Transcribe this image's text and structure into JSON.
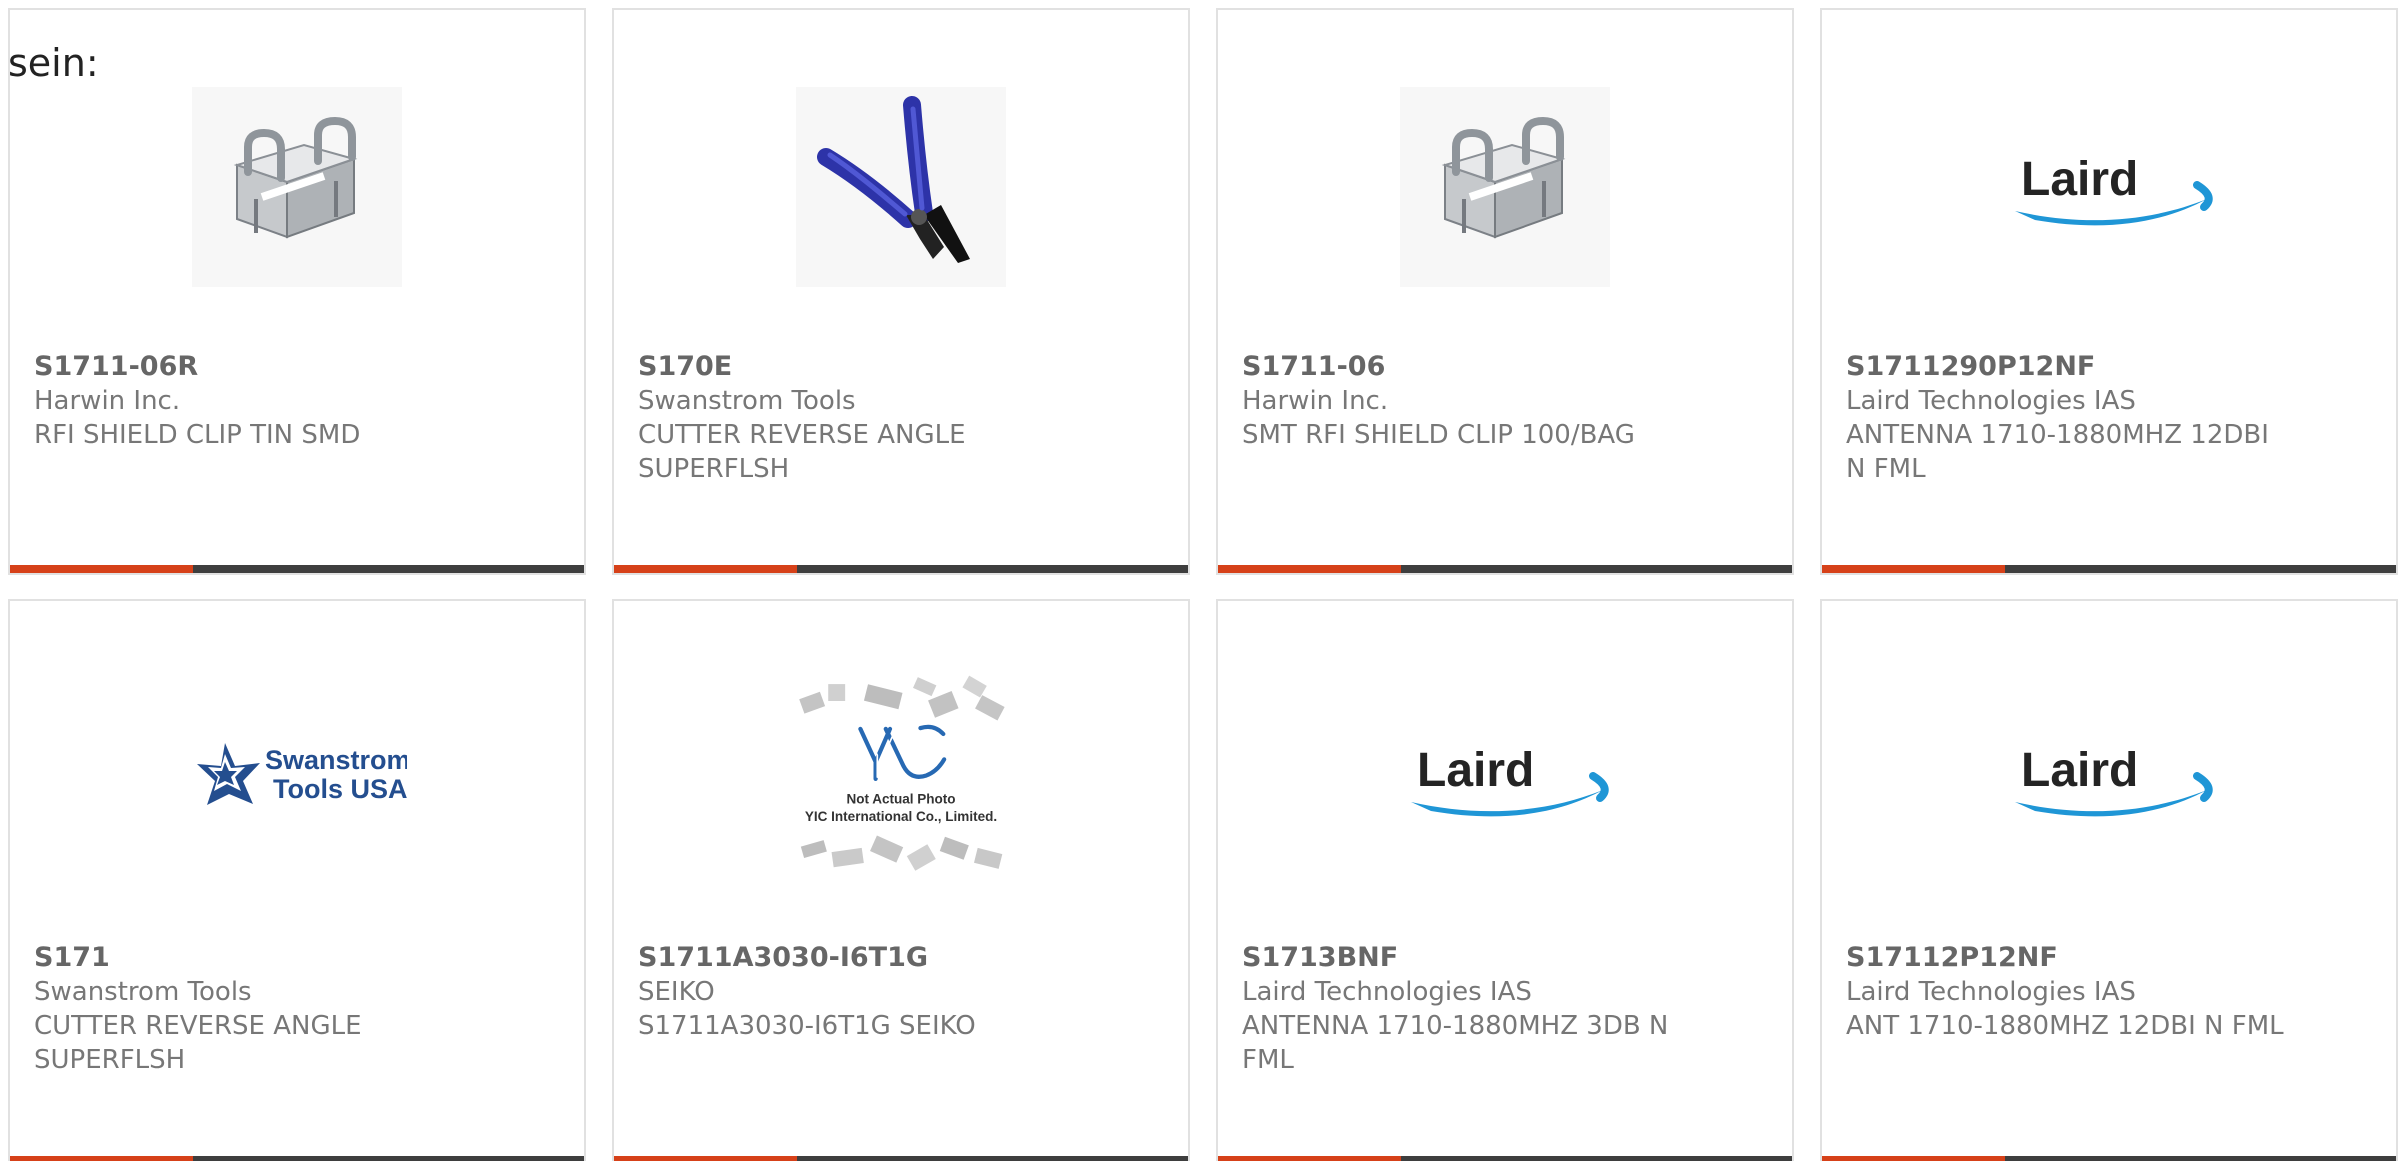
{
  "page": {
    "lead_text": "sein:"
  },
  "products": [
    {
      "part_number": "S1711-06R",
      "manufacturer": "Harwin Inc.",
      "description": "RFI SHIELD CLIP TIN SMD",
      "image_type": "shield-clip-photo"
    },
    {
      "part_number": "S170E",
      "manufacturer": "Swanstrom Tools",
      "description": "CUTTER REVERSE ANGLE SUPERFLSH",
      "image_type": "cutter-photo"
    },
    {
      "part_number": "S1711-06",
      "manufacturer": "Harwin Inc.",
      "description": "SMT RFI SHIELD CLIP 100/BAG",
      "image_type": "shield-clip-photo"
    },
    {
      "part_number": "S1711290P12NF",
      "manufacturer": "Laird Technologies IAS",
      "description": "ANTENNA 1710-1880MHZ 12DBI N FML",
      "image_type": "laird-logo",
      "logo_text": "Laird"
    },
    {
      "part_number": "S171",
      "manufacturer": "Swanstrom Tools",
      "description": "CUTTER REVERSE ANGLE SUPERFLSH",
      "image_type": "swanstrom-logo",
      "logo_line_1": "Swanstrom",
      "logo_line_2": "Tools USA"
    },
    {
      "part_number": "S1711A3030-I6T1G",
      "manufacturer": "SEIKO",
      "description": "S1711A3030-I6T1G SEIKO",
      "image_type": "not-actual-photo",
      "photo_line_1": "Not Actual Photo",
      "photo_line_2": "YIC International Co., Limited."
    },
    {
      "part_number": "S1713BNF",
      "manufacturer": "Laird Technologies IAS",
      "description": "ANTENNA 1710-1880MHZ 3DB N FML",
      "image_type": "laird-logo",
      "logo_text": "Laird"
    },
    {
      "part_number": "S17112P12NF",
      "manufacturer": "Laird Technologies IAS",
      "description": "ANT 1710-1880MHZ 12DBI N FML",
      "image_type": "laird-logo",
      "logo_text": "Laird"
    }
  ],
  "colors": {
    "accent_red": "#d64119",
    "accent_dark": "#3e3e3e",
    "card_border": "#e1e1e1",
    "laird_swoosh": "#1f96d6",
    "swanstrom_navy": "#244e8f",
    "cutter_handle": "#2d33a8"
  }
}
